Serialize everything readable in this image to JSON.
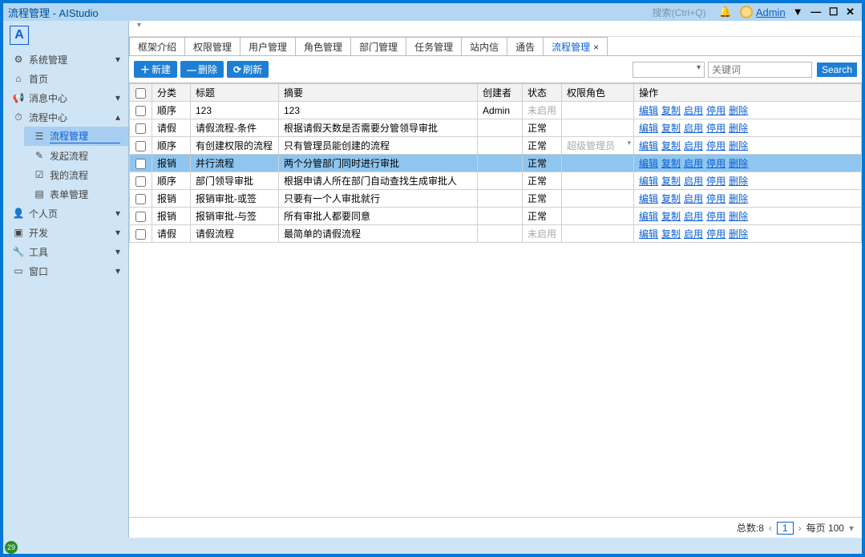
{
  "window": {
    "title": "流程管理 - AIStudio",
    "search_hint": "搜索(Ctrl+Q)",
    "user": "Admin"
  },
  "sidebar": {
    "items": [
      {
        "icon": "⚙",
        "label": "系统管理",
        "chev": "▾"
      },
      {
        "icon": "⌂",
        "label": "首页"
      },
      {
        "icon": "📢",
        "label": "消息中心",
        "chev": "▾"
      },
      {
        "icon": "⏱",
        "label": "流程中心",
        "chev": "▴",
        "expanded": true,
        "children": [
          {
            "icon": "☰",
            "label": "流程管理",
            "active": true
          },
          {
            "icon": "✎",
            "label": "发起流程"
          },
          {
            "icon": "☑",
            "label": "我的流程"
          },
          {
            "icon": "▤",
            "label": "表单管理"
          }
        ]
      },
      {
        "icon": "👤",
        "label": "个人页",
        "chev": "▾"
      },
      {
        "icon": "▣",
        "label": "开发",
        "chev": "▾"
      },
      {
        "icon": "🔧",
        "label": "工具",
        "chev": "▾"
      },
      {
        "icon": "▭",
        "label": "窗口",
        "chev": "▾"
      }
    ]
  },
  "tabs": [
    {
      "label": "框架介绍"
    },
    {
      "label": "权限管理"
    },
    {
      "label": "用户管理"
    },
    {
      "label": "角色管理"
    },
    {
      "label": "部门管理"
    },
    {
      "label": "任务管理"
    },
    {
      "label": "站内信"
    },
    {
      "label": "通告"
    },
    {
      "label": "流程管理",
      "active": true,
      "closable": true
    }
  ],
  "actions": {
    "new": "新建",
    "delete": "删除",
    "refresh": "刷新",
    "keyword_placeholder": "关键词",
    "search": "Search"
  },
  "columns": {
    "category": "分类",
    "title": "标题",
    "summary": "摘要",
    "creator": "创建者",
    "status": "状态",
    "role": "权限角色",
    "operate": "操作"
  },
  "op": {
    "edit": "编辑",
    "copy": "复制",
    "enable": "启用",
    "disable": "停用",
    "delete": "删除"
  },
  "rows": [
    {
      "category": "顺序",
      "title": "123",
      "summary": "123",
      "creator": "Admin",
      "status": "未启用",
      "status_disabled": true,
      "role": ""
    },
    {
      "category": "请假",
      "title": "请假流程-条件",
      "summary": "根据请假天数是否需要分管领导审批",
      "creator": "",
      "status": "正常",
      "role": ""
    },
    {
      "category": "顺序",
      "title": "有创建权限的流程",
      "summary": "只有管理员能创建的流程",
      "creator": "",
      "status": "正常",
      "role": "超级管理员",
      "role_dim": true
    },
    {
      "category": "报销",
      "title": "并行流程",
      "summary": "两个分管部门同时进行审批",
      "creator": "",
      "status": "正常",
      "role": "",
      "selected": true
    },
    {
      "category": "顺序",
      "title": "部门领导审批",
      "summary": "根据申请人所在部门自动查找生成审批人",
      "creator": "",
      "status": "正常",
      "role": ""
    },
    {
      "category": "报销",
      "title": "报销审批-或签",
      "summary": "只要有一个人审批就行",
      "creator": "",
      "status": "正常",
      "role": ""
    },
    {
      "category": "报销",
      "title": "报销审批-与签",
      "summary": "所有审批人都要同意",
      "creator": "",
      "status": "正常",
      "role": ""
    },
    {
      "category": "请假",
      "title": "请假流程",
      "summary": "最简单的请假流程",
      "creator": "",
      "status": "未启用",
      "status_disabled": true,
      "role": ""
    }
  ],
  "footer": {
    "total_label": "总数:8",
    "page": "1",
    "per_page": "每页 100"
  },
  "corner_badge": "29"
}
